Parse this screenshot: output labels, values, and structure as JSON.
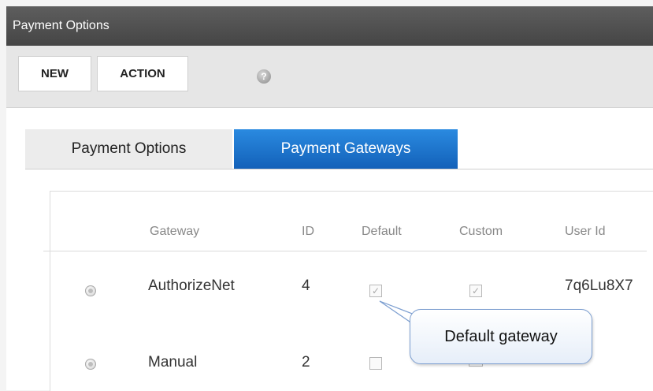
{
  "window": {
    "title": "Payment Options"
  },
  "toolbar": {
    "new_label": "NEW",
    "action_label": "ACTION",
    "help_icon": "help-icon"
  },
  "tabs": [
    {
      "label": "Payment Options",
      "active": false
    },
    {
      "label": "Payment Gateways",
      "active": true
    }
  ],
  "table": {
    "columns": [
      "Gateway",
      "ID",
      "Default",
      "Custom",
      "User Id"
    ],
    "rows": [
      {
        "gateway": "AuthorizeNet",
        "id": "4",
        "default": true,
        "custom": true,
        "user_id": "7q6Lu8X7"
      },
      {
        "gateway": "Manual",
        "id": "2",
        "default": false,
        "custom": false,
        "user_id": ""
      }
    ]
  },
  "tooltip": {
    "text": "Default gateway"
  },
  "colors": {
    "active_tab": "#1a6fc9",
    "titlebar": "#4f4f4f",
    "tooltip_border": "#7c9ed0"
  }
}
